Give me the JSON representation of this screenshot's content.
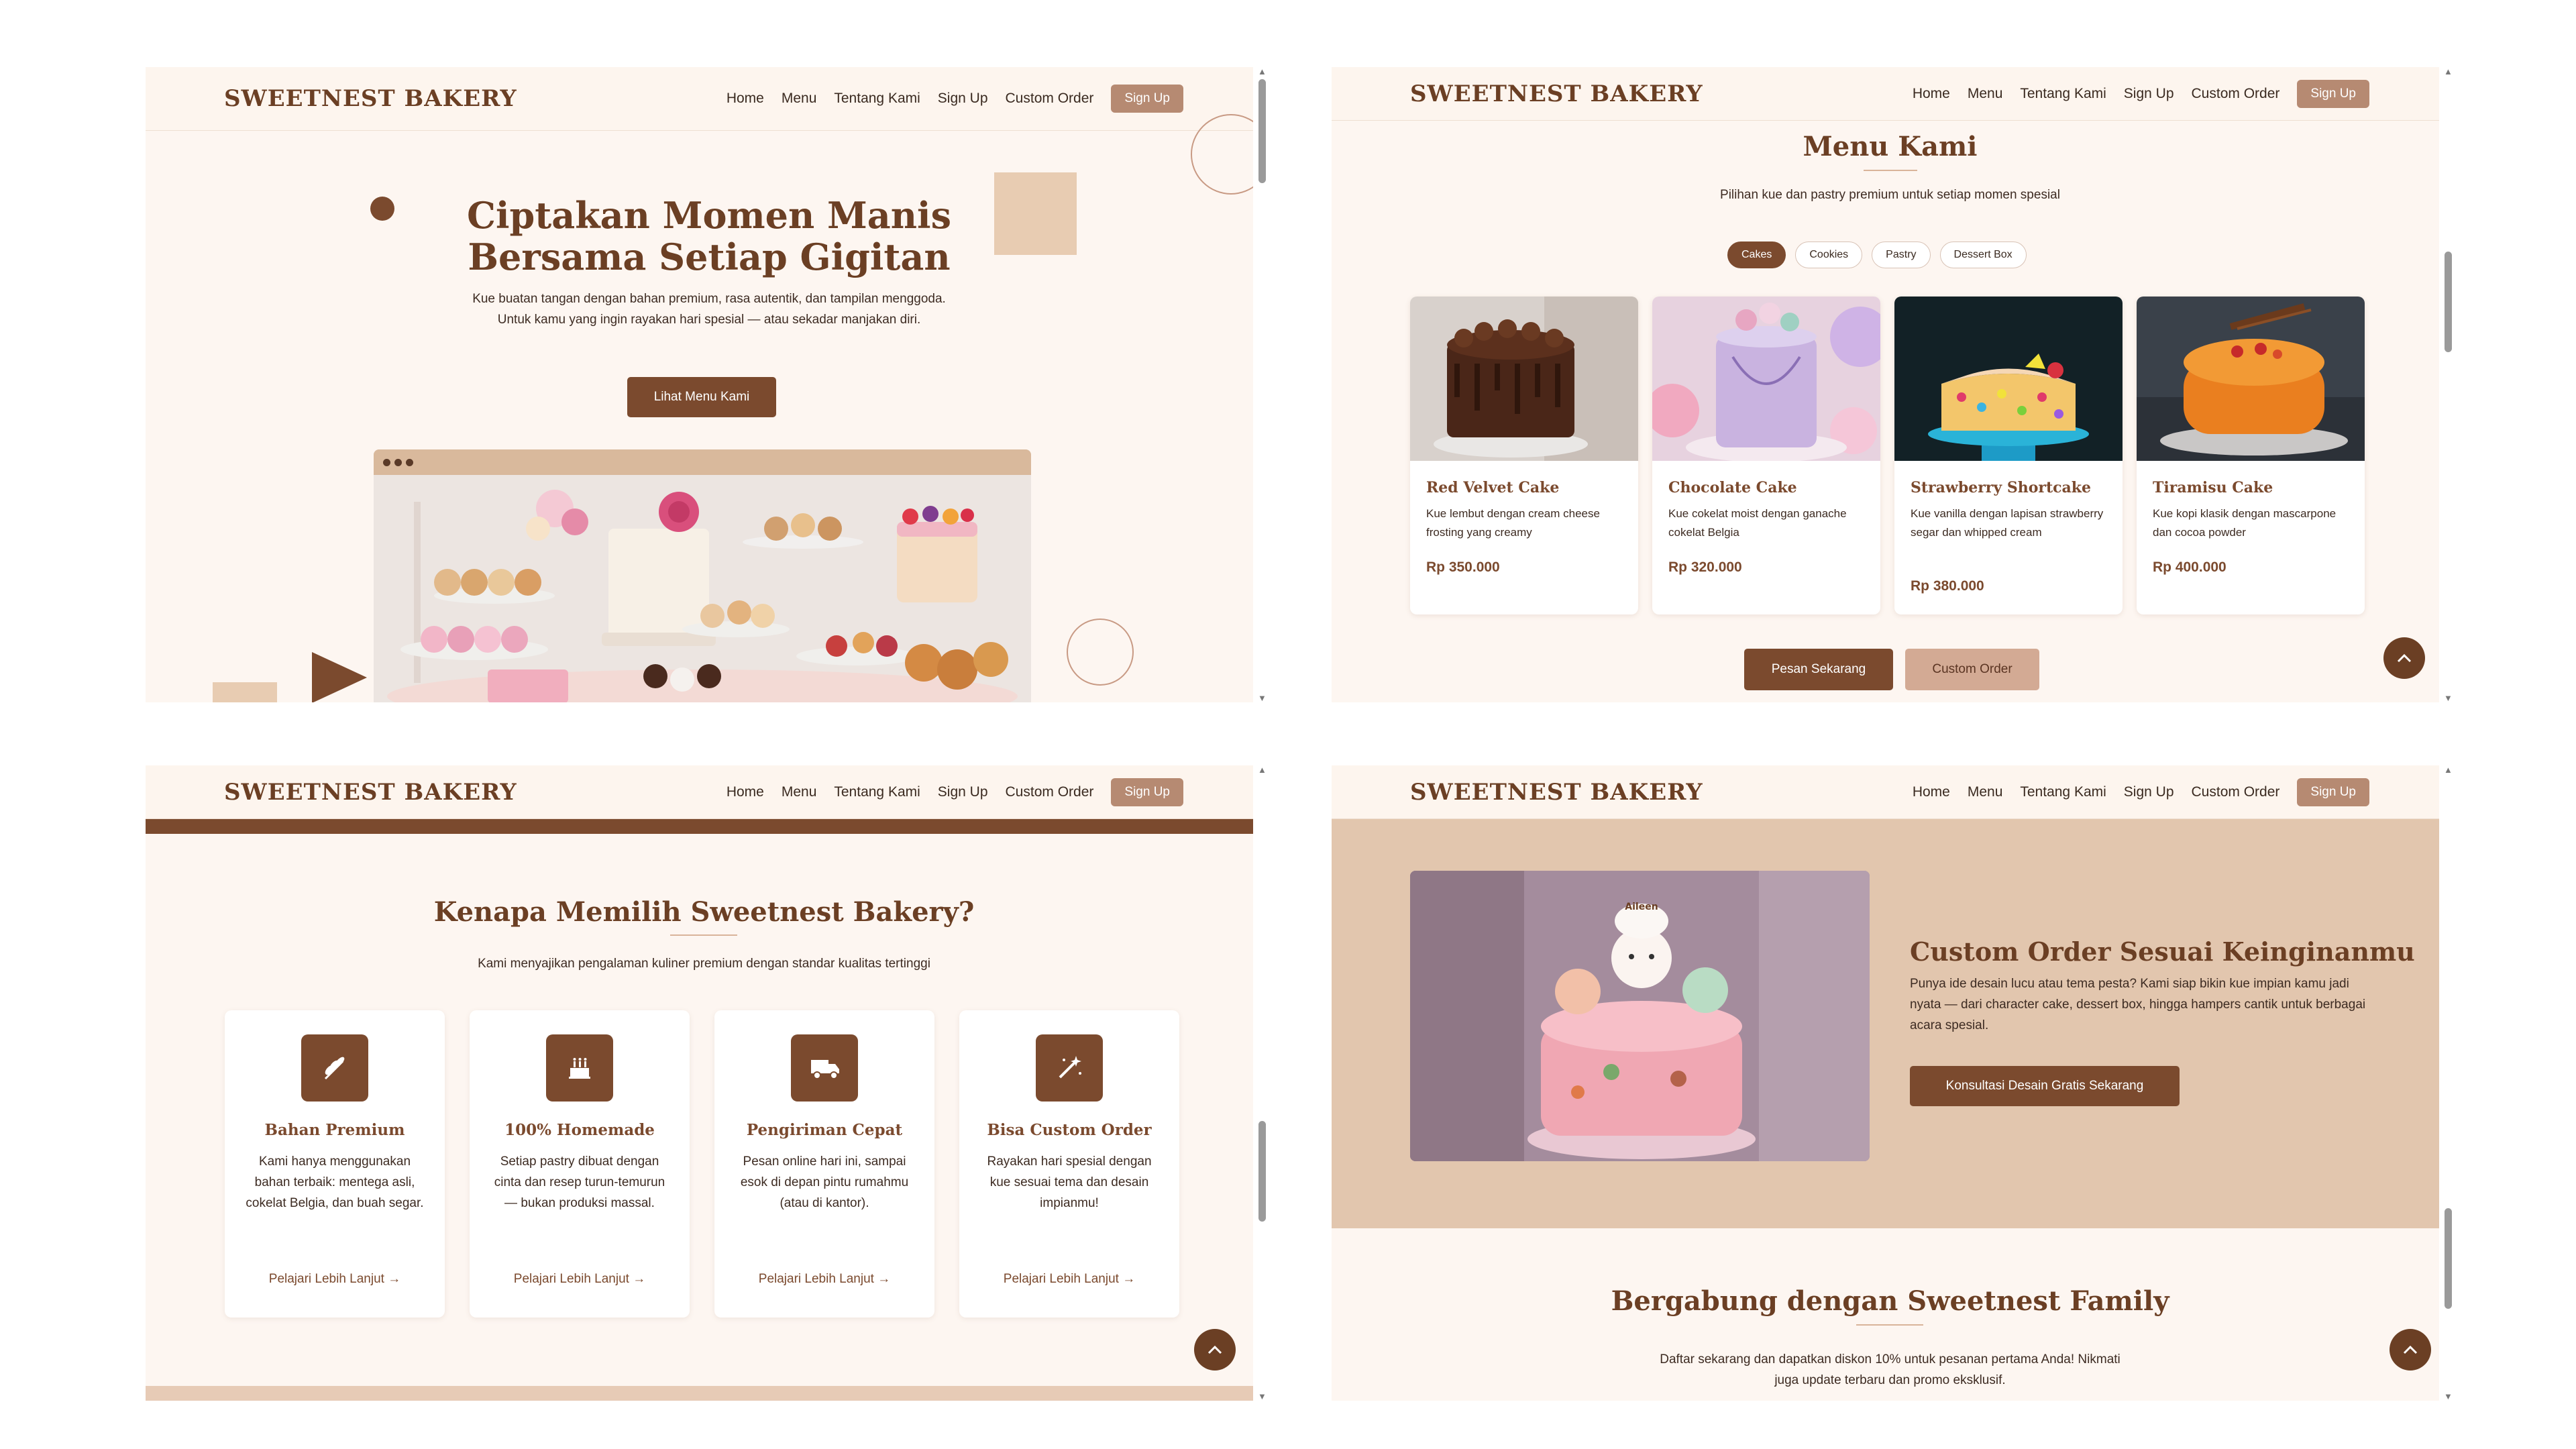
{
  "colors": {
    "brand": "#6b3f24",
    "primary_button": "#7b4a2e",
    "secondary_button": "#d3aa94",
    "page_background": "#fdf6f1",
    "beige_section": "#e2c6ae"
  },
  "nav": {
    "brand": "SWEETNEST BAKERY",
    "items": [
      "Home",
      "Menu",
      "Tentang Kami",
      "Sign Up",
      "Custom Order"
    ],
    "signup_button": "Sign Up"
  },
  "hero": {
    "title": "Ciptakan Momen Manis Bersama Setiap Gigitan",
    "description": "Kue buatan tangan dengan bahan premium, rasa autentik, dan tampilan menggoda. Untuk kamu yang ingin rayakan hari spesial — atau sekadar manjakan diri.",
    "cta": "Lihat Menu Kami"
  },
  "menu": {
    "title": "Menu Kami",
    "subtitle": "Pilihan kue dan pastry premium untuk setiap momen spesial",
    "filters": [
      "Cakes",
      "Cookies",
      "Pastry",
      "Dessert Box"
    ],
    "active_filter": "Cakes",
    "items": [
      {
        "name": "Red Velvet Cake",
        "description": "Kue lembut dengan cream cheese frosting yang creamy",
        "price": "Rp 350.000"
      },
      {
        "name": "Chocolate Cake",
        "description": "Kue cokelat moist dengan ganache cokelat Belgia",
        "price": "Rp 320.000"
      },
      {
        "name": "Strawberry Shortcake",
        "description": "Kue vanilla dengan lapisan strawberry segar dan whipped cream",
        "price": "Rp 380.000"
      },
      {
        "name": "Tiramisu Cake",
        "description": "Kue kopi klasik dengan mascarpone dan cocoa powder",
        "price": "Rp 400.000"
      }
    ],
    "order_button": "Pesan Sekarang",
    "custom_button": "Custom Order"
  },
  "features": {
    "title": "Kenapa Memilih Sweetnest Bakery?",
    "subtitle": "Kami menyajikan pengalaman kuliner premium dengan standar kualitas tertinggi",
    "items": [
      {
        "icon": "wheat-icon",
        "title": "Bahan Premium",
        "description": "Kami hanya menggunakan bahan terbaik: mentega asli, cokelat Belgia, dan buah segar.",
        "link": "Pelajari Lebih Lanjut →"
      },
      {
        "icon": "cake-icon",
        "title": "100% Homemade",
        "description": "Setiap pastry dibuat dengan cinta dan resep turun-temurun — bukan produksi massal.",
        "link": "Pelajari Lebih Lanjut →"
      },
      {
        "icon": "truck-icon",
        "title": "Pengiriman Cepat",
        "description": "Pesan online hari ini, sampai esok di depan pintu rumahmu (atau di kantor).",
        "link": "Pelajari Lebih Lanjut →"
      },
      {
        "icon": "magic-wand-icon",
        "title": "Bisa Custom Order",
        "description": "Rayakan hari spesial dengan kue sesuai tema dan desain impianmu!",
        "link": "Pelajari Lebih Lanjut →"
      }
    ]
  },
  "custom_order": {
    "title": "Custom Order Sesuai Keinginanmu",
    "description": "Punya ide desain lucu atau tema pesta? Kami siap bikin kue impian kamu jadi nyata — dari character cake, dessert box, hingga hampers cantik untuk berbagai acara spesial.",
    "cta": "Konsultasi Desain Gratis Sekarang",
    "cake_topper_text": "Aileen"
  },
  "join": {
    "title": "Bergabung dengan Sweetnest Family",
    "description": "Daftar sekarang dan dapatkan diskon 10% untuk pesanan pertama Anda! Nikmati juga update terbaru dan promo eksklusif."
  }
}
